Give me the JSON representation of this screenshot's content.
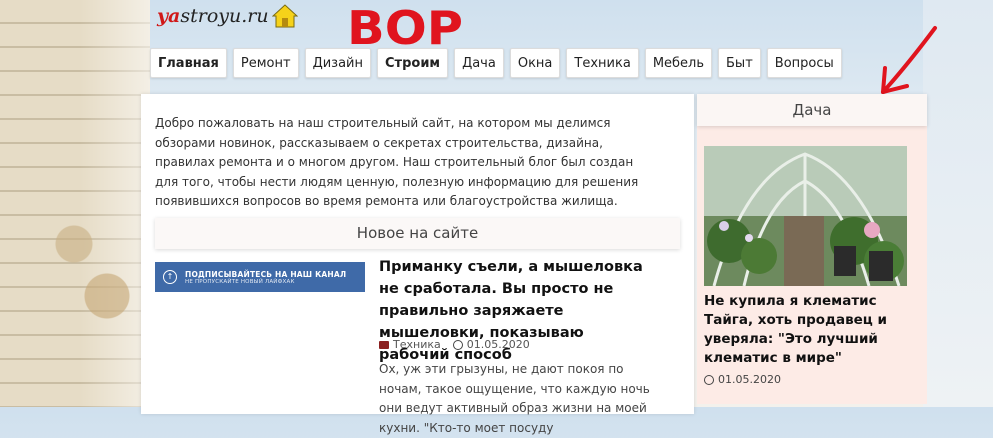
{
  "logo": {
    "part1": "ya",
    "part2": "stroyu.ru"
  },
  "annotation": {
    "text": "ВОР"
  },
  "nav": {
    "items": [
      "Главная",
      "Ремонт",
      "Дизайн",
      "Строим",
      "Дача",
      "Окна",
      "Техника",
      "Мебель",
      "Быт",
      "Вопросы"
    ],
    "active": [
      "Главная",
      "Строим"
    ]
  },
  "main": {
    "intro": "Добро пожаловать на наш строительный сайт, на котором мы делимся обзорами новинок, рассказываем о секретах строительства, дизайна, правилах ремонта и о многом другом. Наш строительный блог был создан для того, чтобы нести людям ценную, полезную информацию для решения появившихся вопросов во время ремонта или благоустройства жилища.",
    "section_title": "Новое на сайте",
    "banner": {
      "line1": "ПОДПИСЫВАЙТЕСЬ НА НАШ КАНАЛ",
      "line2": "НЕ ПРОПУСКАЙТЕ НОВЫЙ ЛАЙФХАК"
    },
    "article": {
      "title": "Приманку съели, а мышеловка не сработала. Вы просто не правильно заряжаете мышеловки, показываю рабочий способ",
      "category": "Техника",
      "date": "01.05.2020",
      "excerpt": "Ох, уж эти грызуны, не дают покоя по ночам, такое ощущение, что каждую ночь они ведут активный образ жизни на моей кухни. \"Кто-то моет посуду"
    }
  },
  "sidebar": {
    "title": "Дача",
    "article": {
      "title": "Не купила я клематис Тайга, хоть продавец и уверяла: \"Это лучший клематис в мире\"",
      "date": "01.05.2020"
    }
  },
  "colors": {
    "logo_red": "#d01818",
    "annotation_red": "#e0141e",
    "banner_blue": "#3f6aa8",
    "sidebar_bg": "#fdebe6"
  }
}
